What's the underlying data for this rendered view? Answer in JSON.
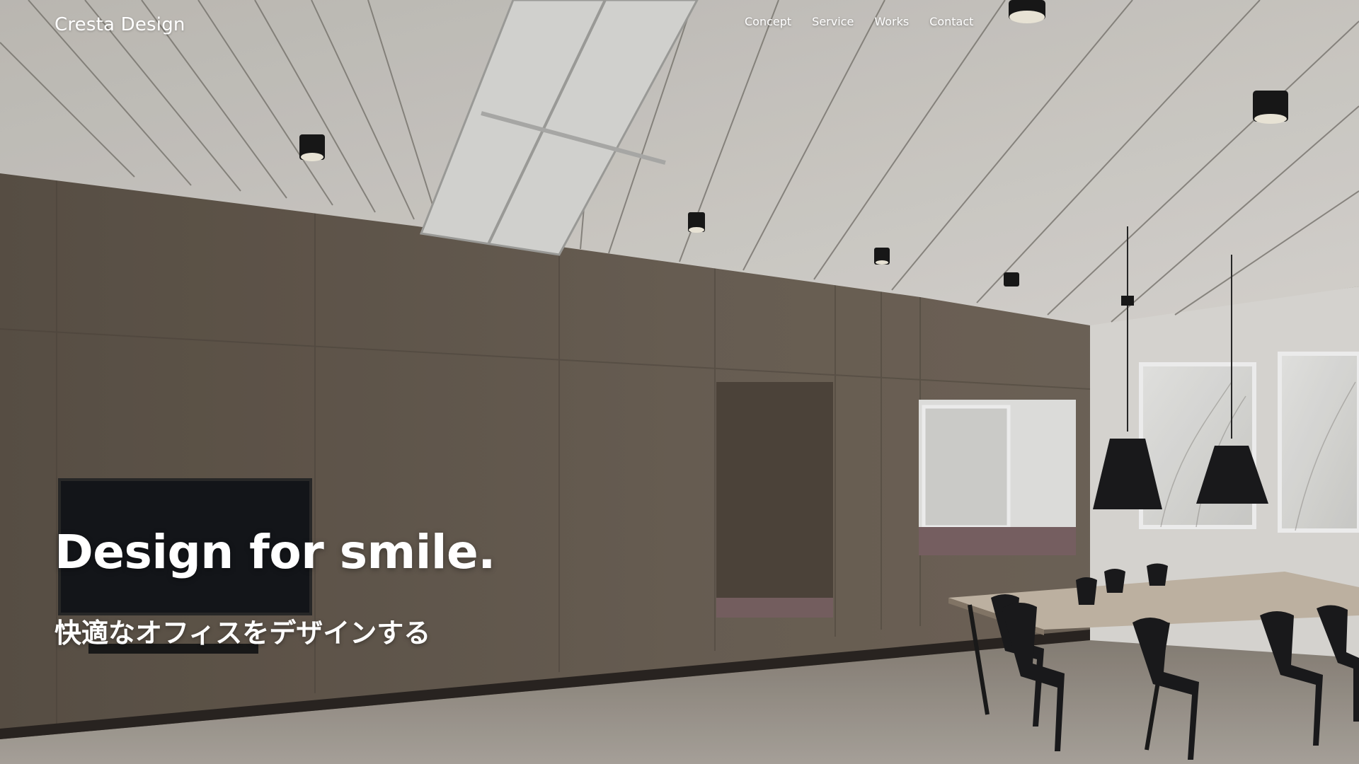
{
  "header": {
    "logo_text": "Cresta Design",
    "nav": [
      {
        "label": "Concept"
      },
      {
        "label": "Service"
      },
      {
        "label": "Works"
      },
      {
        "label": "Contact"
      }
    ]
  },
  "hero": {
    "title": "Design for smile.",
    "subtitle": "快適なオフィスをデザインする",
    "photo_subject": "office-interior-photo"
  },
  "colors": {
    "text": "#ffffff",
    "wall_wood": "#6e6357",
    "ceiling": "#d9d6cf",
    "floor": "#a39c93",
    "furniture": "#1d1d1f"
  }
}
